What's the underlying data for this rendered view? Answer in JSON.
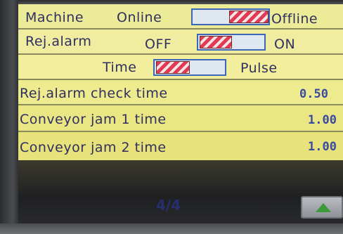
{
  "machine": {
    "label": "Machine",
    "online": "Online",
    "offline": "Offline"
  },
  "rej_alarm": {
    "label": "Rej.alarm",
    "off": "OFF",
    "on": "ON"
  },
  "alarm_mode": {
    "time": "Time",
    "pulse": "Pulse"
  },
  "settings": [
    {
      "label": "Rej.alarm check time",
      "value": "0.50"
    },
    {
      "label": "Conveyor jam 1 time",
      "value": "1.00"
    },
    {
      "label": "Conveyor jam 2 time",
      "value": "1.00"
    }
  ],
  "footer": {
    "page": "4/4",
    "up_icon": "triangle-up-icon"
  },
  "colors": {
    "panel": "#e6e48a",
    "text": "#2f2f60",
    "value": "#3a4aa0",
    "toggle_hatch": "#e23a52",
    "toggle_border": "#3e66b8"
  }
}
